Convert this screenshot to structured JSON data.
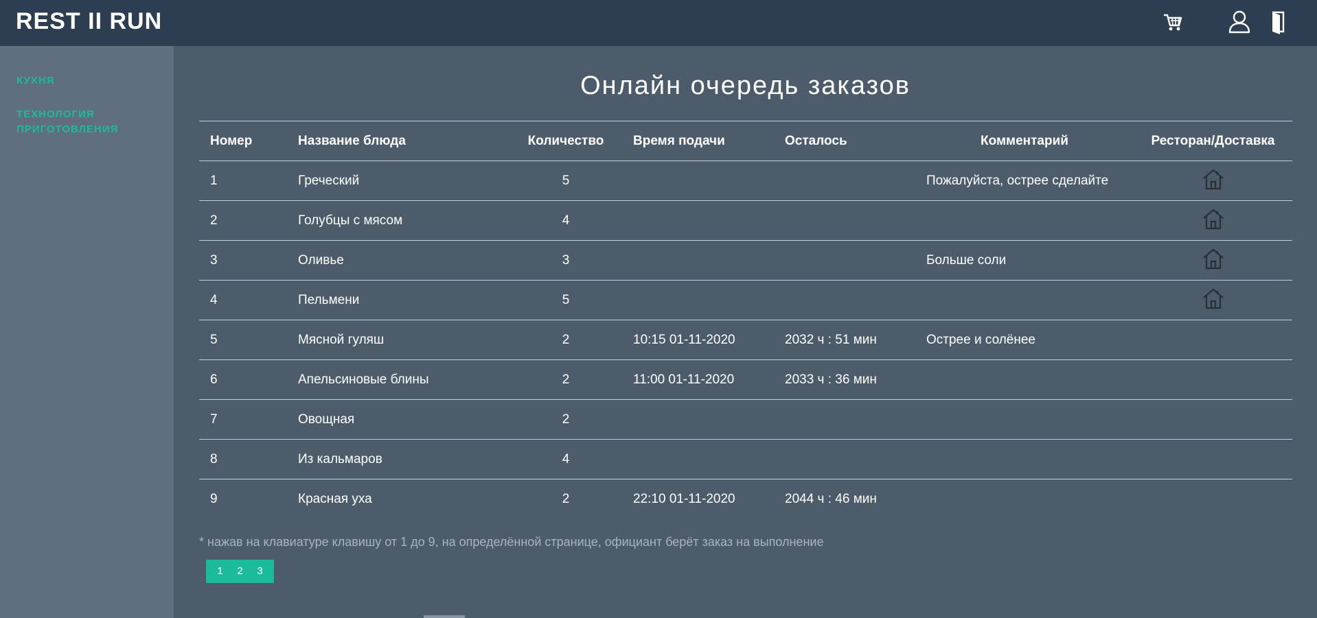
{
  "app": {
    "brand": "REST II RUN"
  },
  "header": {
    "icons": [
      "cart-icon",
      "user-icon",
      "logout-door-icon"
    ]
  },
  "sidebar": {
    "items": [
      {
        "label": "КУХНЯ"
      },
      {
        "label": "ТЕХНОЛОГИЯ ПРИГОТОВЛЕНИЯ"
      }
    ]
  },
  "main": {
    "title": "Онлайн очередь заказов",
    "columns": [
      "Номер",
      "Название блюда",
      "Количество",
      "Время подачи",
      "Осталось",
      "Комментарий",
      "Ресторан/Доставка"
    ],
    "rows": [
      {
        "num": "1",
        "name": "Греческий",
        "qty": "5",
        "time": "",
        "left": "",
        "comment": "Пожалуйста, острее сделайте",
        "place_icon": "house-icon"
      },
      {
        "num": "2",
        "name": "Голубцы с мясом",
        "qty": "4",
        "time": "",
        "left": "",
        "comment": "",
        "place_icon": "house-icon"
      },
      {
        "num": "3",
        "name": "Оливье",
        "qty": "3",
        "time": "",
        "left": "",
        "comment": "Больше соли",
        "place_icon": "house-icon"
      },
      {
        "num": "4",
        "name": "Пельмени",
        "qty": "5",
        "time": "",
        "left": "",
        "comment": "",
        "place_icon": "house-icon"
      },
      {
        "num": "5",
        "name": "Мясной гуляш",
        "qty": "2",
        "time": "10:15 01-11-2020",
        "left": "2032 ч : 51 мин",
        "comment": "Острее и солёнее",
        "place_icon": ""
      },
      {
        "num": "6",
        "name": "Апельсиновые блины",
        "qty": "2",
        "time": "11:00 01-11-2020",
        "left": "2033 ч : 36 мин",
        "comment": "",
        "place_icon": ""
      },
      {
        "num": "7",
        "name": "Овощная",
        "qty": "2",
        "time": "",
        "left": "",
        "comment": "",
        "place_icon": ""
      },
      {
        "num": "8",
        "name": "Из кальмаров",
        "qty": "4",
        "time": "",
        "left": "",
        "comment": "",
        "place_icon": ""
      },
      {
        "num": "9",
        "name": "Красная уха",
        "qty": "2",
        "time": "22:10 01-11-2020",
        "left": "2044 ч : 46 мин",
        "comment": "",
        "place_icon": ""
      }
    ],
    "note": "* нажав на клавиатуре клавишу от 1 до 9, на определённой странице, официант берёт заказ на выполнение",
    "pages": [
      "1",
      "2",
      "3"
    ]
  },
  "colors": {
    "header_bg": "#2c3e50",
    "sidebar_bg": "#5f6f80",
    "main_bg": "#4d5c6b",
    "accent": "#1abc9c"
  }
}
